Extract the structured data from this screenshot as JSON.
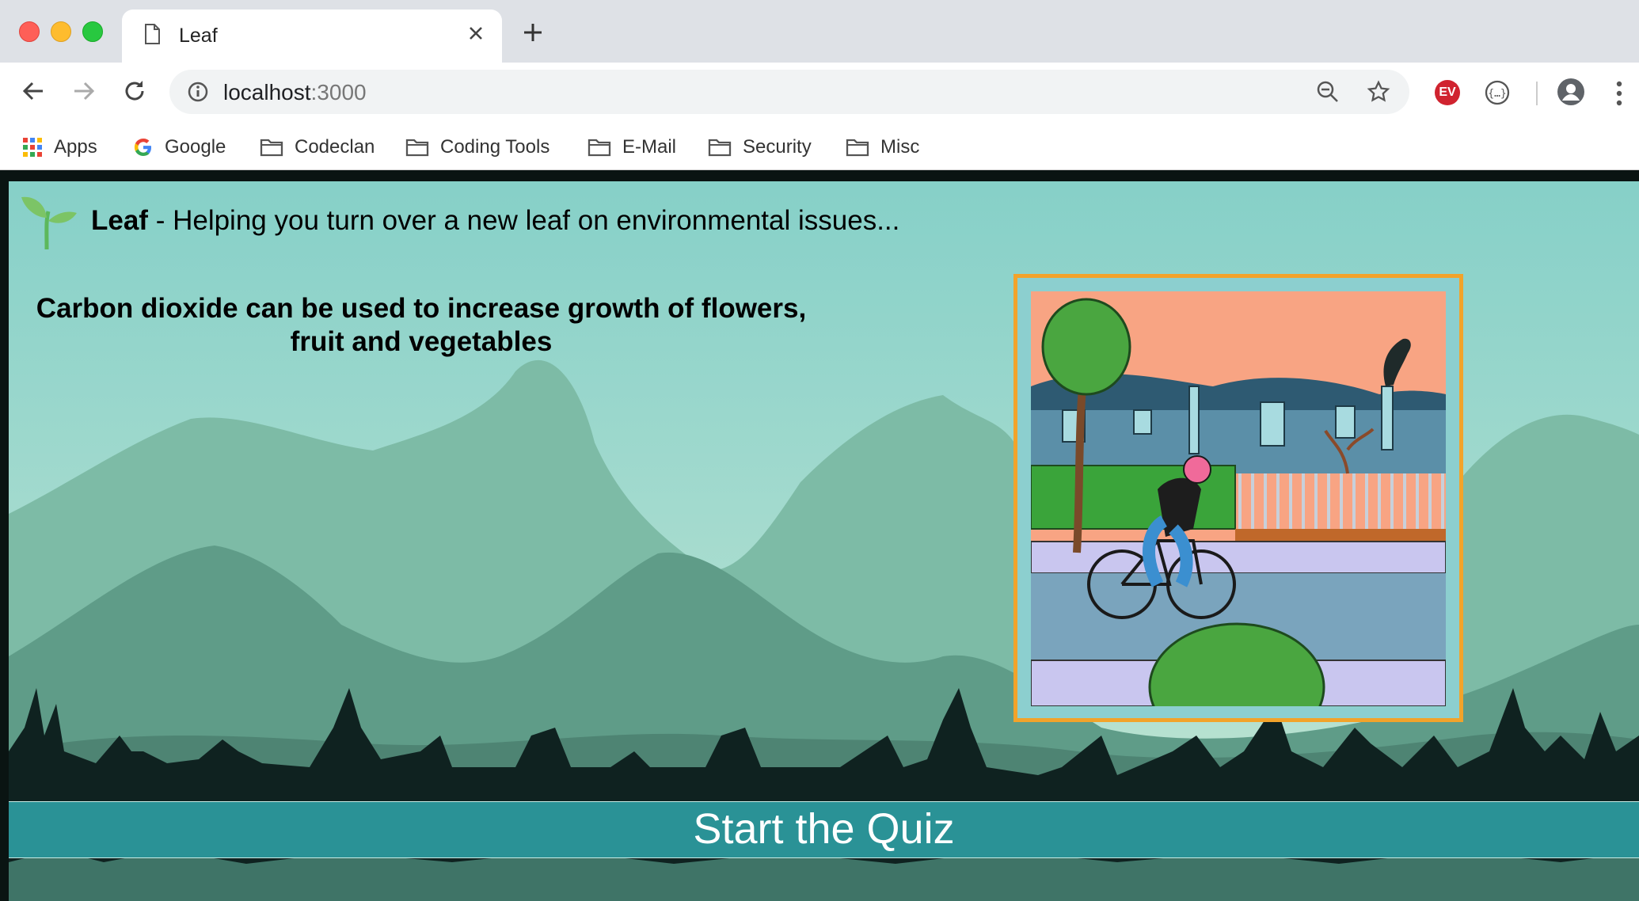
{
  "browser": {
    "tab": {
      "title": "Leaf"
    },
    "url": {
      "host": "localhost",
      "port": ":3000"
    },
    "bookmarks": [
      {
        "label": "Apps",
        "icon": "apps-grid-icon"
      },
      {
        "label": "Google",
        "icon": "google-icon"
      },
      {
        "label": "Codeclan",
        "icon": "folder-icon"
      },
      {
        "label": "Coding Tools",
        "icon": "folder-icon"
      },
      {
        "label": "E-Mail",
        "icon": "folder-icon"
      },
      {
        "label": "Security",
        "icon": "folder-icon"
      },
      {
        "label": "Misc",
        "icon": "folder-icon"
      }
    ],
    "extensions": {
      "vpn": "EV"
    }
  },
  "page": {
    "header": {
      "brand": "Leaf",
      "tagline": " - Helping you turn over a new leaf on environmental issues..."
    },
    "fact": "Carbon dioxide can be used to increase growth of flowers, fruit and vegetables",
    "quiz_button": "Start the Quiz"
  },
  "colors": {
    "accent_frame": "#f2a32a",
    "quiz_bar": "#2a9296",
    "sky_top": "#86d0c8"
  }
}
